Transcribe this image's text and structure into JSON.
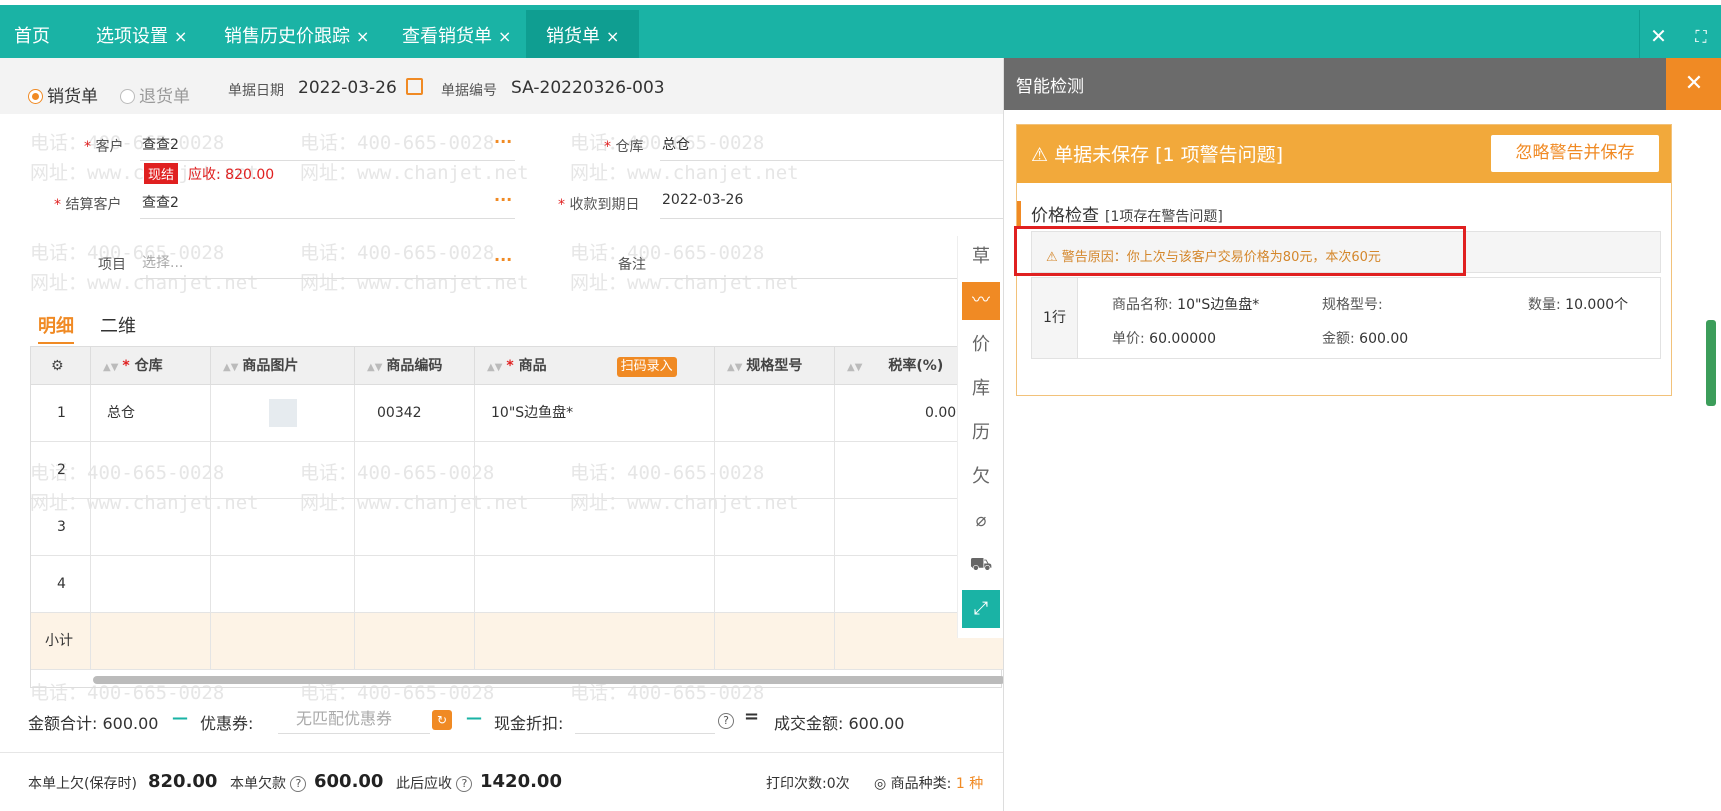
{
  "tabs": [
    {
      "label": "首页"
    },
    {
      "label": "选项设置",
      "close": "×"
    },
    {
      "label": "销售历史价跟踪",
      "close": "×"
    },
    {
      "label": "查看销货单",
      "close": "×"
    },
    {
      "label": "销货单",
      "close": "×"
    }
  ],
  "window": {
    "close": "✕",
    "fullscreen": "⛶"
  },
  "watermark": {
    "phone": "电话：400-665-0028",
    "site": "网址：www.chanjet.net"
  },
  "doc": {
    "type_sale": "销货单",
    "type_return": "退货单",
    "date_label": "单据日期",
    "date_value": "2022-03-26",
    "no_label": "单据编号",
    "no_value": "SA-20220326-003"
  },
  "form": {
    "customer_label": "客户",
    "customer_value": "查查2",
    "badge": "现结",
    "receivable": "应收: 820.00",
    "settle_label": "结算客户",
    "settle_value": "查查2",
    "project_label": "项目",
    "project_placeholder": "选择...",
    "warehouse_label": "仓库",
    "warehouse_value": "总仓",
    "due_label": "收款到期日",
    "due_value": "2022-03-26",
    "remark_label": "备注",
    "more": "···"
  },
  "subtabs": {
    "detail": "明细",
    "qr": "二维"
  },
  "grid": {
    "headers": {
      "warehouse": "仓库",
      "image": "商品图片",
      "code": "商品编码",
      "product": "商品",
      "scan": "扫码录入",
      "spec": "规格型号",
      "tax": "税率(%)"
    },
    "rows": [
      {
        "no": "1",
        "warehouse": "总仓",
        "code": "00342",
        "product": "10\"S边鱼盘*",
        "tax": "0.00%"
      },
      {
        "no": "2"
      },
      {
        "no": "3"
      },
      {
        "no": "4"
      }
    ],
    "subtotal": "小计"
  },
  "totals": {
    "amount_label": "金额合计:",
    "amount_value": "600.00",
    "coupon_label": "优惠券:",
    "coupon_placeholder": "无匹配优惠券",
    "discount_label": "现金折扣:",
    "deal_label": "成交金额:",
    "deal_value": "600.00"
  },
  "footer": {
    "prev_debt_label": "本单上欠(保存时)",
    "prev_debt_value": "820.00",
    "owed_label": "本单欠款",
    "owed_value": "600.00",
    "after_label": "此后应收",
    "after_value": "1420.00",
    "print_count": "打印次数:0次",
    "kinds_label": "商品种类:",
    "kinds_value": "1 种"
  },
  "sidebar": [
    "草",
    "",
    "价",
    "库",
    "历",
    "欠",
    "",
    "",
    ""
  ],
  "panel": {
    "title": "智能检测",
    "close": "✕",
    "warn_title": "单据未保存 [1 项警告问题]",
    "ignore_btn": "忽略警告并保存",
    "section": "价格检查",
    "section_count_pre": "[1项",
    "section_count_post": "存在警告问题]",
    "reason": "警告原因：你上次与该客户交易价格为80元，本次60元",
    "row_idx": "1行",
    "name_label": "商品名称:",
    "name_value": "10\"S边鱼盘*",
    "spec_label": "规格型号:",
    "qty_label": "数量:",
    "qty_value": "10.000个",
    "price_label": "单价:",
    "price_value": "60.00000",
    "amount_label": "金额:",
    "amount_value": "600.00"
  },
  "colors": {
    "teal": "#1ab3a5",
    "orange": "#f08a24",
    "warn": "#f2a93b",
    "red": "#e02020"
  }
}
